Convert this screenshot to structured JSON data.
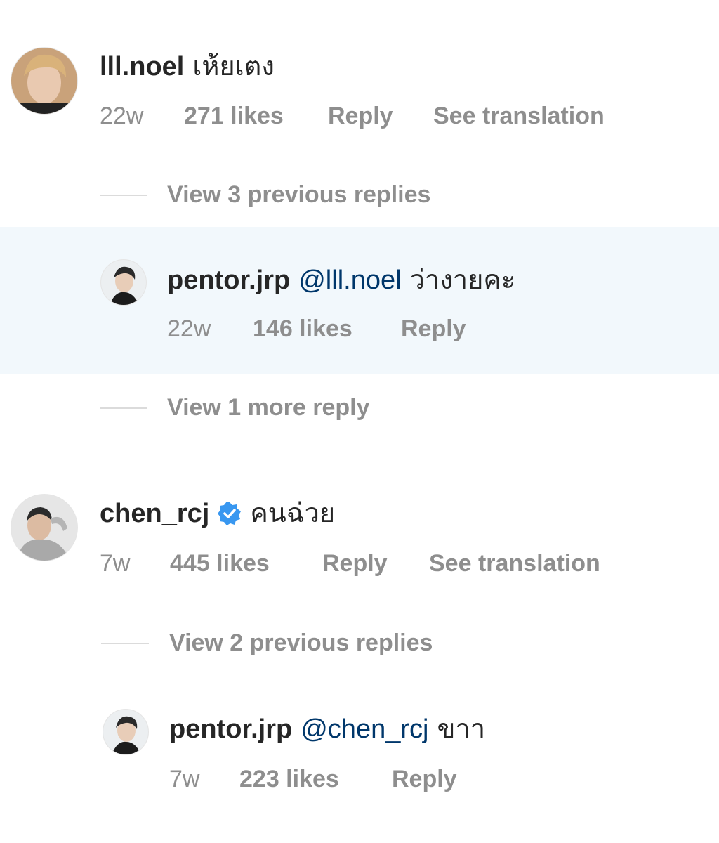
{
  "comments": [
    {
      "username": "lll.noel",
      "text": "เห้ยเตง",
      "age": "22w",
      "likes": "271 likes",
      "reply": "Reply",
      "translate": "See translation",
      "view_replies": "View 3 previous replies"
    },
    {
      "username": "pentor.jrp",
      "mention": "@lll.noel",
      "text": "ว่างายคะ",
      "age": "22w",
      "likes": "146 likes",
      "reply": "Reply",
      "view_replies": "View 1 more reply"
    },
    {
      "username": "chen_rcj",
      "verified_icon": "verified-badge-icon",
      "text": "คนฉ่วย",
      "age": "7w",
      "likes": "445 likes",
      "reply": "Reply",
      "translate": "See translation",
      "view_replies": "View 2 previous replies"
    },
    {
      "username": "pentor.jrp",
      "mention": "@chen_rcj",
      "text": "ขาา",
      "age": "7w",
      "likes": "223 likes",
      "reply": "Reply"
    }
  ],
  "colors": {
    "text": "#262626",
    "meta": "#8e8e8e",
    "mention": "#00376b",
    "highlight_bg": "#f2f8fc",
    "verified": "#3897f0"
  }
}
